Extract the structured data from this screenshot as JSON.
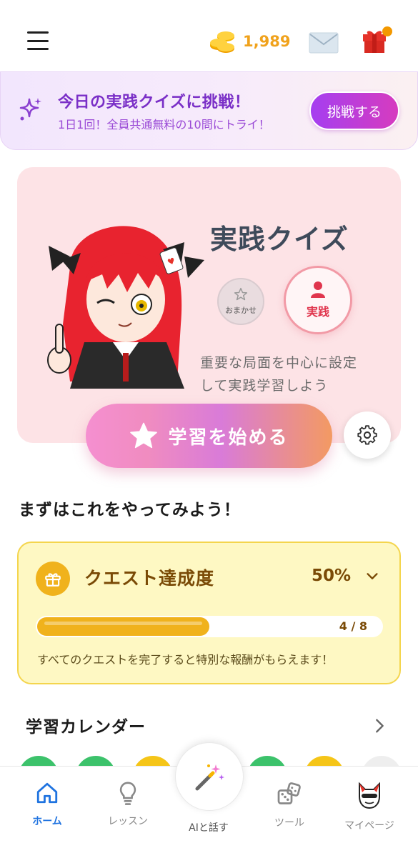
{
  "header": {
    "coins": "1,989",
    "colors": {
      "coin": "#f0a21c",
      "gift": "#e6332a"
    }
  },
  "banner": {
    "title": "今日の実践クイズに挑戦！",
    "subtitle": "1日1回！全員共通無料の10問にトライ！",
    "button_label": "挑戦する"
  },
  "quiz_card": {
    "title": "実践クイズ",
    "mode_random_label": "おまかせ",
    "mode_practice_label": "実践",
    "description": "重要な局面を中心に設定して実践学習しよう"
  },
  "start_button": {
    "label": "学習を始める"
  },
  "section": {
    "title": "まずはこれをやってみよう！"
  },
  "quest": {
    "title": "クエスト達成度",
    "percent": "50%",
    "progress_value": 0.5,
    "count": "4 / 8",
    "note": "すべてのクエストを完了すると特別な報酬がもらえます！"
  },
  "calendar": {
    "title": "学習カレンダー",
    "day_colors": [
      "#3cc26b",
      "#3cc26b",
      "#f5c518",
      "#3cc26b",
      "#3cc26b",
      "#f5c518",
      "#eeeeee"
    ]
  },
  "bottom_nav": {
    "items": [
      {
        "label": "ホーム",
        "icon": "home-icon",
        "active": true
      },
      {
        "label": "レッスン",
        "icon": "lightbulb-icon",
        "active": false
      },
      {
        "label": "AIと話す",
        "icon": "magic-wand-icon",
        "active": false
      },
      {
        "label": "ツール",
        "icon": "dice-icon",
        "active": false
      },
      {
        "label": "マイページ",
        "icon": "avatar-icon",
        "active": false
      }
    ]
  }
}
